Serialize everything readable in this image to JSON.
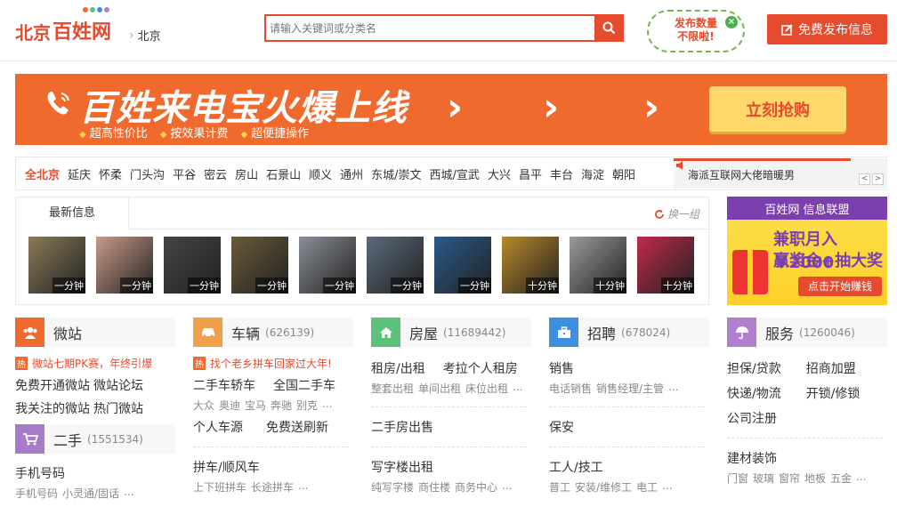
{
  "header": {
    "logo_city": "北京",
    "logo_brand": "百姓网",
    "crumb_city": "北京",
    "search_placeholder": "请输入关键词或分类名",
    "free_badge_line1": "发布数量",
    "free_badge_line2": "不限啦!",
    "post_button": "免费发布信息"
  },
  "banner": {
    "title": "百姓来电宝火爆上线",
    "features": [
      "超高性价比",
      "按效果计费",
      "超便捷操作"
    ],
    "cta": "立刻抢购"
  },
  "districts": [
    "全北京",
    "延庆",
    "怀柔",
    "门头沟",
    "平谷",
    "密云",
    "房山",
    "石景山",
    "顺义",
    "通州",
    "东城/崇文",
    "西城/宣武",
    "大兴",
    "昌平",
    "丰台",
    "海淀",
    "朝阳"
  ],
  "ticker": {
    "text": "海派互联网大佬暗暖男",
    "prev": "<",
    "next": ">"
  },
  "latest": {
    "tab": "最新信息",
    "refresh": "换一组",
    "items": [
      {
        "time": "一分钟",
        "color": "#8a7a5a"
      },
      {
        "time": "一分钟",
        "color": "#c89a8a"
      },
      {
        "time": "一分钟",
        "color": "#444444"
      },
      {
        "time": "一分钟",
        "color": "#6a5a3a"
      },
      {
        "time": "一分钟",
        "color": "#8b8f96"
      },
      {
        "time": "一分钟",
        "color": "#5a6a7a"
      },
      {
        "time": "一分钟",
        "color": "#2a5a8a"
      },
      {
        "time": "十分钟",
        "color": "#b8892a"
      },
      {
        "time": "十分钟",
        "color": "#9a9a9a"
      },
      {
        "time": "十分钟",
        "color": "#c02a4a"
      }
    ]
  },
  "ad": {
    "top": "百姓网 信息联盟",
    "line1": "兼职月入￥2000",
    "line2": "赢奖金+抽大奖",
    "button": "点击开始赚钱"
  },
  "categories": {
    "weizhan": {
      "name": "微站",
      "count": "",
      "color": "#f06a2e",
      "hot_badge": "热",
      "hot": "微站七期PK赛，年终引爆",
      "rows": [
        [
          "免费开通微站",
          "微站论坛"
        ],
        [
          "我关注的微站",
          "热门微站"
        ]
      ]
    },
    "ershou": {
      "name": "二手",
      "count": "(1551534)",
      "color": "#a67bc9",
      "row1": "手机号码",
      "sub1": [
        "手机号码",
        "小灵通/固话",
        "..."
      ]
    },
    "cheliang": {
      "name": "车辆",
      "count": "(626139)",
      "color": "#f0a04a",
      "hot_badge": "热",
      "hot": "找个老乡拼车回家过大年!",
      "row1": [
        "二手车轿车",
        "全国二手车"
      ],
      "sub1": [
        "大众",
        "奥迪",
        "宝马",
        "奔驰",
        "别克",
        "..."
      ],
      "row2": [
        "个人车源",
        "免费送刷新"
      ],
      "row3": "拼车/顺风车",
      "sub3": [
        "上下班拼车",
        "长途拼车",
        "..."
      ]
    },
    "fangwu": {
      "name": "房屋",
      "count": "(11689442)",
      "color": "#5cc27a",
      "row1": [
        "租房/出租",
        "考拉个人租房"
      ],
      "sub1": [
        "整套出租",
        "单间出租",
        "床位出租",
        "..."
      ],
      "row2": "二手房出售",
      "row3": "写字楼出租",
      "sub3": [
        "纯写字楼",
        "商住楼",
        "商务中心",
        "..."
      ]
    },
    "zhaopin": {
      "name": "招聘",
      "count": "(678024)",
      "color": "#3d8fe0",
      "row1": "销售",
      "sub1": [
        "电话销售",
        "销售经理/主管",
        "..."
      ],
      "row2": "保安",
      "row3": "工人/技工",
      "sub3": [
        "普工",
        "安装/维修工",
        "电工",
        "..."
      ]
    },
    "fuwu": {
      "name": "服务",
      "count": "(1260046)",
      "color": "#b07fd0",
      "rows": [
        [
          "担保/贷款",
          "招商加盟"
        ],
        [
          "快递/物流",
          "开锁/修锁"
        ]
      ],
      "row3": "公司注册",
      "row4": "建材装饰",
      "sub4": [
        "门窗",
        "玻璃",
        "窗帘",
        "地板",
        "五金",
        "..."
      ]
    }
  }
}
